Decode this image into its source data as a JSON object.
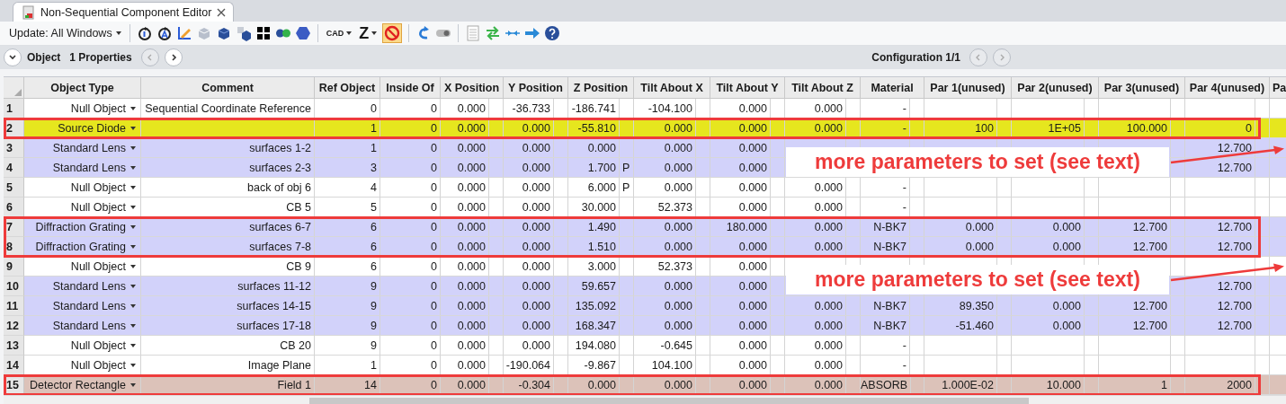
{
  "tab": {
    "title": "Non-Sequential Component Editor"
  },
  "toolbar": {
    "update_label": "Update: All Windows",
    "cad_label": "CAD",
    "z_label": "Z",
    "block_button_on": true
  },
  "object_bar": {
    "object_label": "Object",
    "properties_label": "1 Properties",
    "configuration": "Configuration 1/1"
  },
  "table": {
    "columns": [
      {
        "label": "Object Type",
        "kind": "type"
      },
      {
        "label": "Comment",
        "kind": "plain"
      },
      {
        "label": "Ref Object",
        "kind": "plain"
      },
      {
        "label": "Inside Of",
        "kind": "plain"
      },
      {
        "label": "X Position",
        "kind": "value"
      },
      {
        "label": "Y Position",
        "kind": "value"
      },
      {
        "label": "Z Position",
        "kind": "value_solve"
      },
      {
        "label": "Tilt About X",
        "kind": "value"
      },
      {
        "label": "Tilt About Y",
        "kind": "value"
      },
      {
        "label": "Tilt About Z",
        "kind": "value"
      },
      {
        "label": "Material",
        "kind": "value"
      },
      {
        "label": "Par 1(unused)",
        "kind": "value"
      },
      {
        "label": "Par 2(unused)",
        "kind": "value"
      },
      {
        "label": "Par 3(unused)",
        "kind": "value"
      },
      {
        "label": "Par 4(unused)",
        "kind": "value"
      },
      {
        "label": "Pa",
        "kind": "cut"
      }
    ],
    "rows": [
      {
        "num": "1",
        "color": "#ffffff",
        "highlighted": false,
        "cells": [
          "Null Object",
          "Sequential Coordinate Reference",
          "0",
          "0",
          "0.000",
          "-36.733",
          "-186.741",
          "-104.100",
          "0.000",
          "0.000",
          "-",
          null,
          null,
          null,
          null
        ]
      },
      {
        "num": "2",
        "color": "#e6e61e",
        "highlighted": true,
        "cells": [
          "Source Diode",
          null,
          "1",
          "0",
          "0.000",
          "0.000",
          "-55.810",
          "0.000",
          "0.000",
          "0.000",
          "-",
          "100",
          "1E+05",
          "100.000",
          "0"
        ]
      },
      {
        "num": "3",
        "color": "#d2d2fa",
        "highlighted": false,
        "cells": [
          "Standard Lens",
          "surfaces 1-2",
          "1",
          "0",
          "0.000",
          "0.000",
          "0.000",
          "0.000",
          "0.000",
          null,
          null,
          null,
          null,
          null,
          "12.700"
        ]
      },
      {
        "num": "4",
        "color": "#d2d2fa",
        "highlighted": false,
        "solve": "P",
        "cells": [
          "Standard Lens",
          "surfaces 2-3",
          "3",
          "0",
          "0.000",
          "0.000",
          "1.700",
          "0.000",
          "0.000",
          null,
          null,
          null,
          null,
          null,
          "12.700"
        ]
      },
      {
        "num": "5",
        "color": "#ffffff",
        "highlighted": false,
        "solve": "P",
        "cells": [
          "Null Object",
          "back of obj 6",
          "4",
          "0",
          "0.000",
          "0.000",
          "6.000",
          "0.000",
          "0.000",
          "0.000",
          "-",
          null,
          null,
          null,
          null
        ]
      },
      {
        "num": "6",
        "color": "#ffffff",
        "highlighted": false,
        "cells": [
          "Null Object",
          "CB 5",
          "5",
          "0",
          "0.000",
          "0.000",
          "30.000",
          "52.373",
          "0.000",
          "0.000",
          "-",
          null,
          null,
          null,
          null
        ]
      },
      {
        "num": "7",
        "color": "#d2d2fa",
        "highlighted": true,
        "cells": [
          "Diffraction Grating",
          "surfaces 6-7",
          "6",
          "0",
          "0.000",
          "0.000",
          "1.490",
          "0.000",
          "180.000",
          "0.000",
          "N-BK7",
          "0.000",
          "0.000",
          "12.700",
          "12.700"
        ]
      },
      {
        "num": "8",
        "color": "#d2d2fa",
        "highlighted": true,
        "cells": [
          "Diffraction Grating",
          "surfaces 7-8",
          "6",
          "0",
          "0.000",
          "0.000",
          "1.510",
          "0.000",
          "0.000",
          "0.000",
          "N-BK7",
          "0.000",
          "0.000",
          "12.700",
          "12.700"
        ]
      },
      {
        "num": "9",
        "color": "#ffffff",
        "highlighted": false,
        "cells": [
          "Null Object",
          "CB 9",
          "6",
          "0",
          "0.000",
          "0.000",
          "3.000",
          "52.373",
          "0.000",
          null,
          null,
          null,
          null,
          null,
          null
        ]
      },
      {
        "num": "10",
        "color": "#d2d2fa",
        "highlighted": false,
        "cells": [
          "Standard Lens",
          "surfaces 11-12",
          "9",
          "0",
          "0.000",
          "0.000",
          "59.657",
          "0.000",
          "0.000",
          null,
          null,
          null,
          null,
          null,
          "12.700"
        ]
      },
      {
        "num": "11",
        "color": "#d2d2fa",
        "highlighted": false,
        "cells": [
          "Standard Lens",
          "surfaces 14-15",
          "9",
          "0",
          "0.000",
          "0.000",
          "135.092",
          "0.000",
          "0.000",
          "0.000",
          "N-BK7",
          "89.350",
          "0.000",
          "12.700",
          "12.700"
        ]
      },
      {
        "num": "12",
        "color": "#d2d2fa",
        "highlighted": false,
        "cells": [
          "Standard Lens",
          "surfaces 17-18",
          "9",
          "0",
          "0.000",
          "0.000",
          "168.347",
          "0.000",
          "0.000",
          "0.000",
          "N-BK7",
          "-51.460",
          "0.000",
          "12.700",
          "12.700"
        ]
      },
      {
        "num": "13",
        "color": "#ffffff",
        "highlighted": false,
        "cells": [
          "Null Object",
          "CB 20",
          "9",
          "0",
          "0.000",
          "0.000",
          "194.080",
          "-0.645",
          "0.000",
          "0.000",
          "-",
          null,
          null,
          null,
          null
        ]
      },
      {
        "num": "14",
        "color": "#ffffff",
        "highlighted": false,
        "cells": [
          "Null Object",
          "Image Plane",
          "1",
          "0",
          "0.000",
          "-190.064",
          "-9.867",
          "104.100",
          "0.000",
          "0.000",
          "-",
          null,
          null,
          null,
          null
        ]
      },
      {
        "num": "15",
        "color": "#dcc2b9",
        "highlighted": true,
        "cells": [
          "Detector Rectangle",
          "Field 1",
          "14",
          "0",
          "0.000",
          "-0.304",
          "0.000",
          "0.000",
          "0.000",
          "0.000",
          "ABSORB",
          "1.000E-02",
          "10.000",
          "1",
          "2000"
        ]
      }
    ]
  },
  "annotations": [
    {
      "text": "more parameters to set (see text)"
    },
    {
      "text": "more parameters to set (see text)"
    }
  ]
}
